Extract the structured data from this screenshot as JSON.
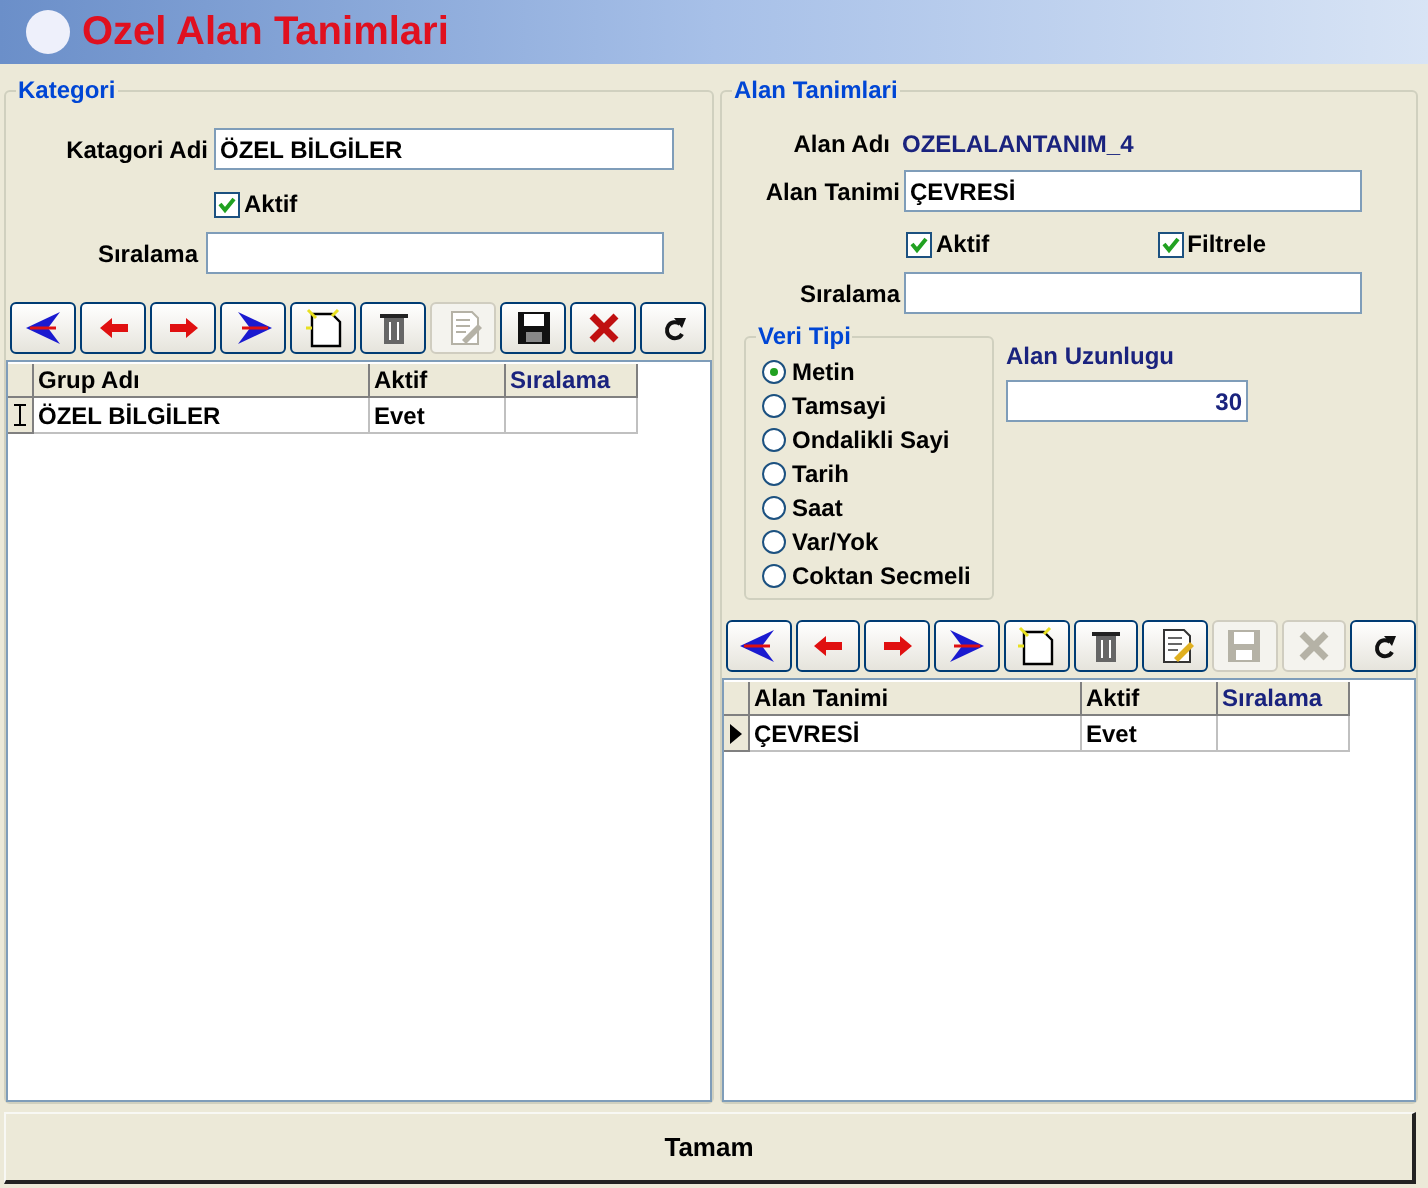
{
  "window": {
    "title": "Ozel Alan Tanimlari"
  },
  "kategori": {
    "legend": "Kategori",
    "name_label": "Katagori Adi",
    "name_value": "ÖZEL BİLGİLER",
    "aktif": {
      "label": "Aktif",
      "checked": true
    },
    "order_label": "Sıralama",
    "toolbar": [
      {
        "kind": "first",
        "disabled": false
      },
      {
        "kind": "prev",
        "disabled": false
      },
      {
        "kind": "next",
        "disabled": false
      },
      {
        "kind": "last",
        "disabled": false
      },
      {
        "kind": "new",
        "disabled": false
      },
      {
        "kind": "delete",
        "disabled": false
      },
      {
        "kind": "edit",
        "disabled": true
      },
      {
        "kind": "save",
        "disabled": false
      },
      {
        "kind": "cancel",
        "disabled": false
      },
      {
        "kind": "refresh",
        "disabled": false
      }
    ],
    "grid": {
      "columns": [
        {
          "label": "Grup Adı",
          "sorted": false
        },
        {
          "label": "Aktif",
          "sorted": false
        },
        {
          "label": "Sıralama",
          "sorted": true
        }
      ],
      "rows": [
        {
          "kind": "editing",
          "cells": [
            "ÖZEL BİLGİLER",
            "Evet",
            ""
          ]
        }
      ]
    }
  },
  "alan": {
    "legend": "Alan Tanimlari",
    "alan_adi_label": "Alan Adı",
    "alan_adi_value": "OZELALANTANIM_4",
    "tanim_label": "Alan Tanimi",
    "tanim_value": "ÇEVRESİ",
    "aktif": {
      "label": "Aktif",
      "checked": true
    },
    "filtrele": {
      "label": "Filtrele",
      "checked": true
    },
    "order_label": "Sıralama",
    "veri_tipi": {
      "legend": "Veri Tipi",
      "options": [
        {
          "label": "Metin",
          "selected": true
        },
        {
          "label": "Tamsayi",
          "selected": false
        },
        {
          "label": "Ondalikli Sayi",
          "selected": false
        },
        {
          "label": "Tarih",
          "selected": false
        },
        {
          "label": "Saat",
          "selected": false
        },
        {
          "label": "Var/Yok",
          "selected": false
        },
        {
          "label": "Coktan Secmeli",
          "selected": false
        }
      ]
    },
    "length_label": "Alan Uzunlugu",
    "length_value": "30",
    "toolbar": [
      {
        "kind": "first",
        "disabled": false
      },
      {
        "kind": "prev",
        "disabled": false
      },
      {
        "kind": "next",
        "disabled": false
      },
      {
        "kind": "last",
        "disabled": false
      },
      {
        "kind": "new",
        "disabled": false
      },
      {
        "kind": "delete",
        "disabled": false
      },
      {
        "kind": "edit",
        "disabled": false
      },
      {
        "kind": "save",
        "disabled": true
      },
      {
        "kind": "cancel",
        "disabled": true
      },
      {
        "kind": "refresh",
        "disabled": false
      }
    ],
    "grid": {
      "columns": [
        {
          "label": "Alan Tanimi",
          "sorted": false
        },
        {
          "label": "Aktif",
          "sorted": false
        },
        {
          "label": "Sıralama",
          "sorted": true
        }
      ],
      "rows": [
        {
          "kind": "current",
          "cells": [
            "ÇEVRESİ",
            "Evet",
            ""
          ]
        }
      ]
    }
  },
  "ok_button": "Tamam"
}
